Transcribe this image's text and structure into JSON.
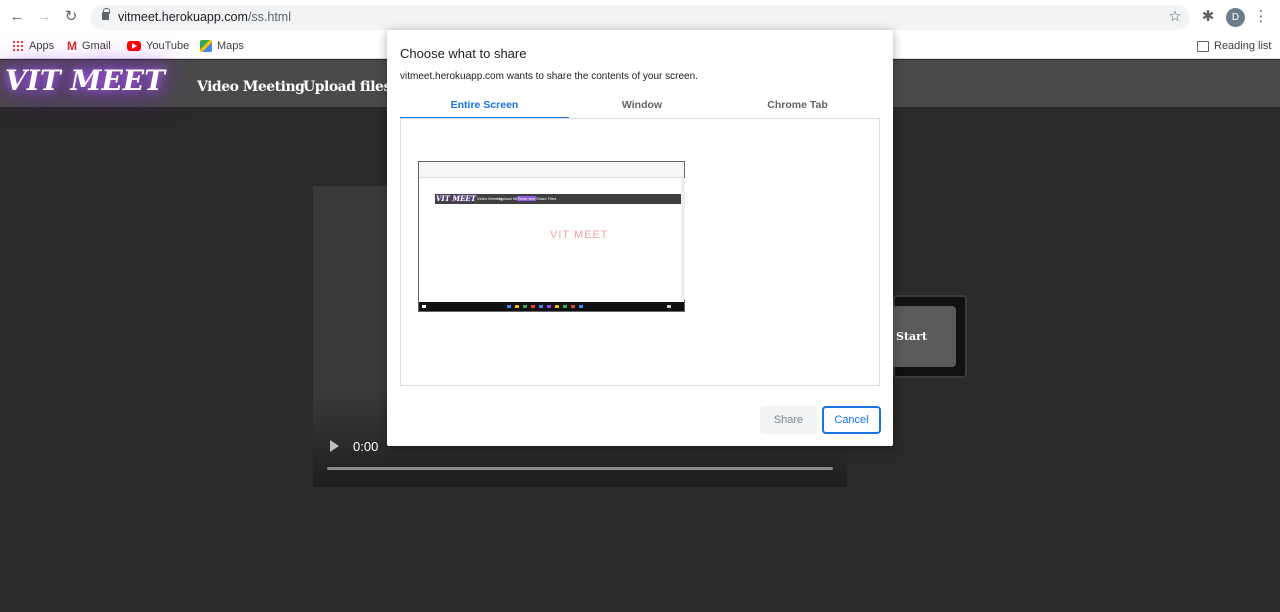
{
  "browser": {
    "url_host": "vitmeet.herokuapp.com",
    "url_path": "/ss.html",
    "avatar_letter": "D",
    "bookmarks": [
      {
        "label": "Apps",
        "icon": "apps-grid-icon"
      },
      {
        "label": "Gmail",
        "icon": "gmail-icon"
      },
      {
        "label": "YouTube",
        "icon": "youtube-icon"
      },
      {
        "label": "Maps",
        "icon": "maps-icon"
      }
    ],
    "reading_list": "Reading list"
  },
  "site": {
    "logo": "VIT MEET",
    "nav": [
      "Video Meeting",
      "Upload files"
    ],
    "video_time": "0:00",
    "start_label": "Start"
  },
  "dialog": {
    "title": "Choose what to share",
    "subtitle": "vitmeet.herokuapp.com wants to share the contents of your screen.",
    "tabs": [
      "Entire Screen",
      "Window",
      "Chrome Tab"
    ],
    "active_tab": "Entire Screen",
    "thumbnail": {
      "logo": "VIT MEET",
      "nav": [
        "Video Meeting",
        "Upload files",
        "Send text",
        "Share Files"
      ],
      "text": "VIT MEET"
    },
    "share_label": "Share",
    "cancel_label": "Cancel"
  },
  "colors": {
    "accent": "#1a73e8",
    "site_header": "#4a4a4a",
    "page_bg": "#2a2a2a",
    "logo_glow": "#8a2be2"
  }
}
